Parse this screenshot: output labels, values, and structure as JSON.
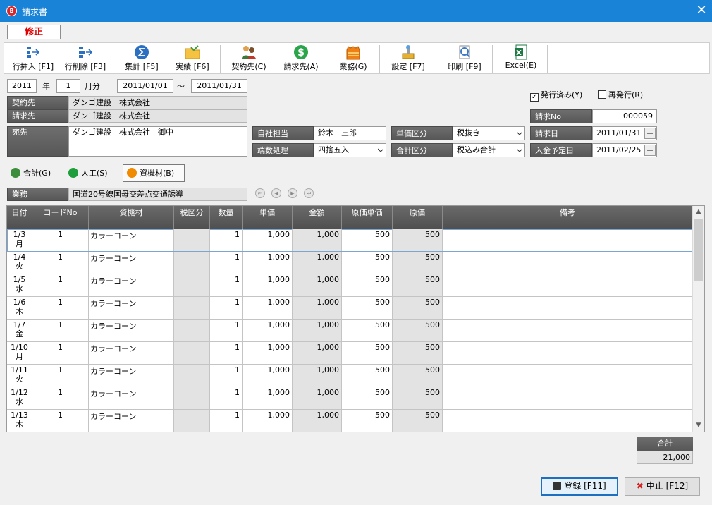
{
  "window": {
    "title": "請求書",
    "close_glyph": "✕"
  },
  "mode_label": "修正",
  "toolbar": [
    {
      "label": "行挿入 [F1]",
      "icon": "insert-row-icon"
    },
    {
      "label": "行削除 [F3]",
      "icon": "delete-row-icon"
    },
    {
      "label": "集計 [F5]",
      "icon": "sigma-icon"
    },
    {
      "label": "実績 [F6]",
      "icon": "folder-icon"
    },
    {
      "label": "契約先(C)",
      "icon": "people-icon"
    },
    {
      "label": "請求先(A)",
      "icon": "dollar-icon"
    },
    {
      "label": "業務(G)",
      "icon": "vest-icon"
    },
    {
      "label": "設定 [F7]",
      "icon": "settings-icon"
    },
    {
      "label": "印刷 [F9]",
      "icon": "print-icon"
    },
    {
      "label": "Excel(E)",
      "icon": "excel-icon"
    }
  ],
  "period": {
    "year": "2011",
    "year_unit": "年",
    "month": "1",
    "month_unit": "月分",
    "from": "2011/01/01",
    "tilde": "～",
    "to": "2011/01/31"
  },
  "flags": {
    "issued_label": "発行済み(Y)",
    "issued_checked": true,
    "reissue_label": "再発行(R)",
    "reissue_checked": false
  },
  "contract": {
    "label": "契約先",
    "value": "ダンゴ建設　株式会社"
  },
  "billto": {
    "label": "請求先",
    "value": "ダンゴ建設　株式会社"
  },
  "address": {
    "label": "宛先",
    "value": "ダンゴ建設　株式会社　御中"
  },
  "staff": {
    "label": "自社担当",
    "value": "鈴木　三郎"
  },
  "price_type": {
    "label": "単価区分",
    "value": "税抜き"
  },
  "rounding": {
    "label": "端数処理",
    "value": "四捨五入"
  },
  "total_type": {
    "label": "合計区分",
    "value": "税込み合計"
  },
  "invoice_no": {
    "label": "請求No",
    "value": "000059"
  },
  "invoice_date": {
    "label": "請求日",
    "value": "2011/01/31"
  },
  "payment_date": {
    "label": "入金予定日",
    "value": "2011/02/25"
  },
  "ellipsis": "…",
  "tabs": [
    {
      "label": "合計(G)",
      "color": "#3c8d3c"
    },
    {
      "label": "人工(S)",
      "color": "#1e9e3a"
    },
    {
      "label": "資機材(B)",
      "color": "#f08a00"
    }
  ],
  "job": {
    "label": "業務",
    "value": "国道20号線国母交差点交通誘導"
  },
  "nav_glyphs": [
    "⏮",
    "◀",
    "▶",
    "⏭"
  ],
  "grid": {
    "columns": [
      "日付",
      "コードNo",
      "資機材",
      "税区分",
      "数量",
      "単価",
      "金額",
      "原価単価",
      "原価",
      "備考"
    ],
    "rows": [
      {
        "date": "1/3",
        "dow": "月",
        "code": "1",
        "item": "カラーコーン",
        "tax": "",
        "qty": "1",
        "price": "1,000",
        "amount": "1,000",
        "cost_price": "500",
        "cost": "500",
        "note": ""
      },
      {
        "date": "1/4",
        "dow": "火",
        "code": "1",
        "item": "カラーコーン",
        "tax": "",
        "qty": "1",
        "price": "1,000",
        "amount": "1,000",
        "cost_price": "500",
        "cost": "500",
        "note": ""
      },
      {
        "date": "1/5",
        "dow": "水",
        "code": "1",
        "item": "カラーコーン",
        "tax": "",
        "qty": "1",
        "price": "1,000",
        "amount": "1,000",
        "cost_price": "500",
        "cost": "500",
        "note": ""
      },
      {
        "date": "1/6",
        "dow": "木",
        "code": "1",
        "item": "カラーコーン",
        "tax": "",
        "qty": "1",
        "price": "1,000",
        "amount": "1,000",
        "cost_price": "500",
        "cost": "500",
        "note": ""
      },
      {
        "date": "1/7",
        "dow": "金",
        "code": "1",
        "item": "カラーコーン",
        "tax": "",
        "qty": "1",
        "price": "1,000",
        "amount": "1,000",
        "cost_price": "500",
        "cost": "500",
        "note": ""
      },
      {
        "date": "1/10",
        "dow": "月",
        "code": "1",
        "item": "カラーコーン",
        "tax": "",
        "qty": "1",
        "price": "1,000",
        "amount": "1,000",
        "cost_price": "500",
        "cost": "500",
        "note": ""
      },
      {
        "date": "1/11",
        "dow": "火",
        "code": "1",
        "item": "カラーコーン",
        "tax": "",
        "qty": "1",
        "price": "1,000",
        "amount": "1,000",
        "cost_price": "500",
        "cost": "500",
        "note": ""
      },
      {
        "date": "1/12",
        "dow": "水",
        "code": "1",
        "item": "カラーコーン",
        "tax": "",
        "qty": "1",
        "price": "1,000",
        "amount": "1,000",
        "cost_price": "500",
        "cost": "500",
        "note": ""
      },
      {
        "date": "1/13",
        "dow": "木",
        "code": "1",
        "item": "カラーコーン",
        "tax": "",
        "qty": "1",
        "price": "1,000",
        "amount": "1,000",
        "cost_price": "500",
        "cost": "500",
        "note": ""
      }
    ]
  },
  "scroll_glyphs": {
    "up": "▲",
    "down": "▼"
  },
  "total": {
    "label": "合計",
    "value": "21,000"
  },
  "buttons": {
    "save": "登録 [F11]",
    "cancel": "中止 [F12]"
  },
  "colors": {
    "titlebar": "#1883d7",
    "mode_text": "#e00000",
    "header_dark": "#5a5a5a",
    "readonly_gray": "#e3e3e3"
  }
}
